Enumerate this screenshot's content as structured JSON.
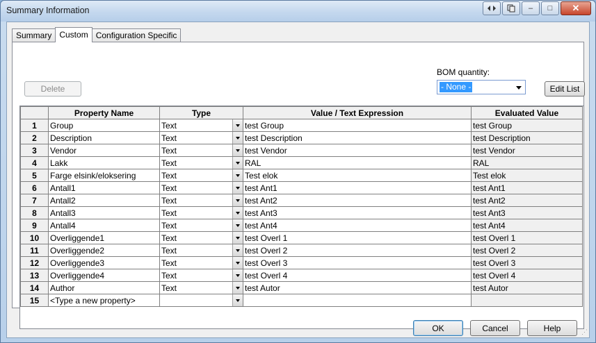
{
  "window": {
    "title": "Summary Information"
  },
  "titlebar_buttons": [
    {
      "icon": "arrows-icon"
    },
    {
      "icon": "copy-icon"
    },
    {
      "icon": "minimize-icon",
      "glyph": "–"
    },
    {
      "icon": "maximize-icon",
      "glyph": "□"
    },
    {
      "icon": "close-icon",
      "glyph": "✕"
    }
  ],
  "tabs": [
    {
      "label": "Summary",
      "active": false
    },
    {
      "label": "Custom",
      "active": true
    },
    {
      "label": "Configuration Specific",
      "active": false
    }
  ],
  "delete_label": "Delete",
  "bom": {
    "label": "BOM quantity:",
    "value": "- None -"
  },
  "edit_list_label": "Edit List",
  "grid": {
    "headers": [
      "",
      "Property Name",
      "Type",
      "Value / Text Expression",
      "Evaluated Value"
    ],
    "rows": [
      {
        "num": "1",
        "name": "Group",
        "type": "Text",
        "value": "test Group",
        "evaluated": "test Group"
      },
      {
        "num": "2",
        "name": "Description",
        "type": "Text",
        "value": "test Description",
        "evaluated": "test Description"
      },
      {
        "num": "3",
        "name": "Vendor",
        "type": "Text",
        "value": "test Vendor",
        "evaluated": "test Vendor"
      },
      {
        "num": "4",
        "name": "Lakk",
        "type": "Text",
        "value": "RAL",
        "evaluated": "RAL"
      },
      {
        "num": "5",
        "name": "Farge elsink/eloksering",
        "type": "Text",
        "value": "Test elok",
        "evaluated": "Test elok"
      },
      {
        "num": "6",
        "name": "Antall1",
        "type": "Text",
        "value": "test Ant1",
        "evaluated": "test Ant1"
      },
      {
        "num": "7",
        "name": "Antall2",
        "type": "Text",
        "value": "test Ant2",
        "evaluated": "test Ant2"
      },
      {
        "num": "8",
        "name": "Antall3",
        "type": "Text",
        "value": "test Ant3",
        "evaluated": "test Ant3"
      },
      {
        "num": "9",
        "name": "Antall4",
        "type": "Text",
        "value": "test Ant4",
        "evaluated": "test Ant4"
      },
      {
        "num": "10",
        "name": "Overliggende1",
        "type": "Text",
        "value": "test Overl 1",
        "evaluated": "test Overl 1"
      },
      {
        "num": "11",
        "name": "Overliggende2",
        "type": "Text",
        "value": "test Overl 2",
        "evaluated": "test Overl 2"
      },
      {
        "num": "12",
        "name": "Overliggende3",
        "type": "Text",
        "value": "test Overl 3",
        "evaluated": "test Overl 3"
      },
      {
        "num": "13",
        "name": "Overliggende4",
        "type": "Text",
        "value": "test Overl 4",
        "evaluated": "test Overl 4"
      },
      {
        "num": "14",
        "name": "Author",
        "type": "Text",
        "value": "test Autor",
        "evaluated": "test Autor"
      },
      {
        "num": "15",
        "name": "<Type a new property>",
        "type": "",
        "value": "",
        "evaluated": ""
      }
    ]
  },
  "buttons": {
    "ok": "OK",
    "cancel": "Cancel",
    "help": "Help"
  }
}
